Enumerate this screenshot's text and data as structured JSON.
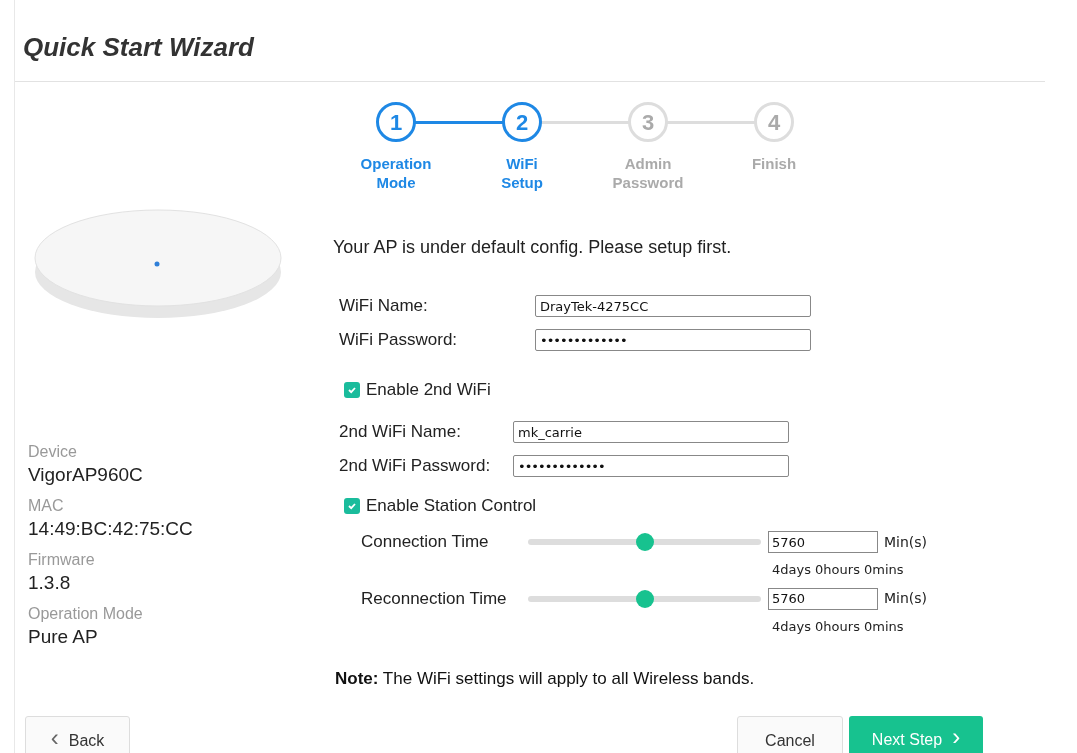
{
  "title": "Quick Start Wizard",
  "steps": [
    {
      "number": "1",
      "label": "Operation Mode",
      "completed": true
    },
    {
      "number": "2",
      "label": "WiFi Setup",
      "completed": false
    },
    {
      "number": "3",
      "label": "Admin Password",
      "completed": false
    },
    {
      "number": "4",
      "label": "Finish",
      "completed": false
    }
  ],
  "device_info": [
    {
      "label": "Device",
      "value": "VigorAP960C"
    },
    {
      "label": "MAC",
      "value": "14:49:BC:42:75:CC"
    },
    {
      "label": "Firmware",
      "value": "1.3.8"
    },
    {
      "label": "Operation Mode",
      "value": "Pure AP"
    }
  ],
  "intro": "Your AP is under default config. Please setup first.",
  "wifi_fields": [
    {
      "label": "WiFi Name:",
      "value": "DrayTek-4275CC",
      "kind": "text"
    },
    {
      "label": "WiFi Password:",
      "value": "•••••••••••••",
      "kind": "password"
    }
  ],
  "enable_2nd_wifi": {
    "label": "Enable 2nd WiFi",
    "checked": true
  },
  "second_wifi_fields": [
    {
      "label": "2nd WiFi Name:",
      "value": "mk_carrie",
      "kind": "text"
    },
    {
      "label": "2nd WiFi Password:",
      "value": "•••••••••••••",
      "kind": "password"
    }
  ],
  "enable_station_control": {
    "label": "Enable Station Control",
    "checked": true
  },
  "station_sliders": [
    {
      "label": "Connection Time",
      "level": 0.5,
      "value": "5760",
      "unit": "Min(s)",
      "reading": "4days 0hours 0mins"
    },
    {
      "label": "Reconnection Time",
      "level": 0.5,
      "value": "5760",
      "unit": "Min(s)",
      "reading": "4days 0hours 0mins"
    }
  ],
  "note": "**Note:** The WiFi settings will apply to all Wireless bands.",
  "buttons": {
    "back": {
      "label": "Back",
      "symbol": "‹"
    },
    "cancel": {
      "label": "Cancel"
    },
    "next": {
      "label": "Next Step",
      "symbol": "›"
    }
  }
}
